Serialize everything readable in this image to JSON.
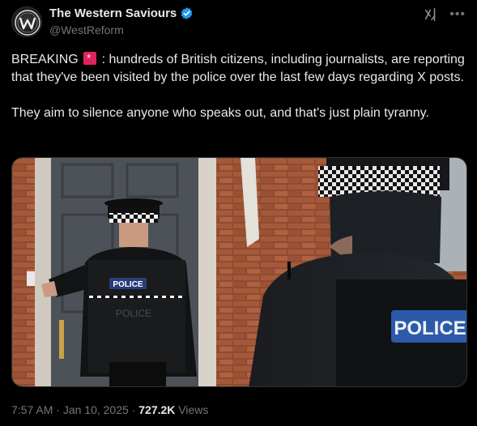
{
  "author": {
    "display_name": "The Western Saviours",
    "handle": "@WestReform",
    "avatar_icon": "w-logo-icon",
    "verified": true
  },
  "tweet": {
    "line1_prefix": "BREAKING",
    "line1_emoji": "rotating-light-emoji",
    "line1_rest": ": hundreds of British citizens, including journalists, are reporting that they've been visited by the police over the last few days regarding X posts.",
    "paragraph2": "They aim to silence anyone who speaks out, and that's just plain tyranny."
  },
  "media": {
    "vest_label_left": "POLICE",
    "vest_label_right": "POLICE",
    "vest_back_text": "POLICE"
  },
  "meta": {
    "time": "7:57 AM",
    "separator": "·",
    "date": "Jan 10, 2025",
    "views_count": "727.2K",
    "views_label": "Views"
  },
  "colors": {
    "background": "#000000",
    "text": "#e7e9ea",
    "muted": "#71767b",
    "verified_blue": "#1d9bf0"
  }
}
